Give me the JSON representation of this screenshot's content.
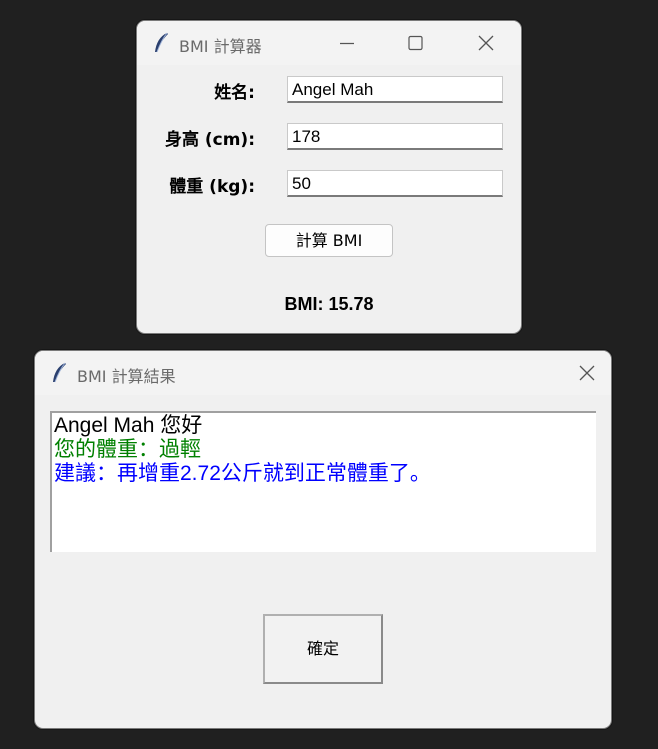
{
  "main_window": {
    "title": "BMI 計算器",
    "name_label": "姓名:",
    "height_label": "身高 (cm):",
    "weight_label": "體重 (kg):",
    "name_value": "Angel Mah",
    "height_value": "178",
    "weight_value": "50",
    "calc_button": "計算 BMI",
    "bmi_result": "BMI: 15.78"
  },
  "result_window": {
    "title": "BMI 計算結果",
    "greeting": "Angel Mah 您好",
    "status": "您的體重：過輕",
    "advice": "建議：再增重2.72公斤就到正常體重了。",
    "ok_button": "確定"
  },
  "colors": {
    "status": "#008000",
    "advice": "#0000ff"
  },
  "icons": [
    "feather-icon",
    "minimize-icon",
    "maximize-icon",
    "close-icon"
  ]
}
